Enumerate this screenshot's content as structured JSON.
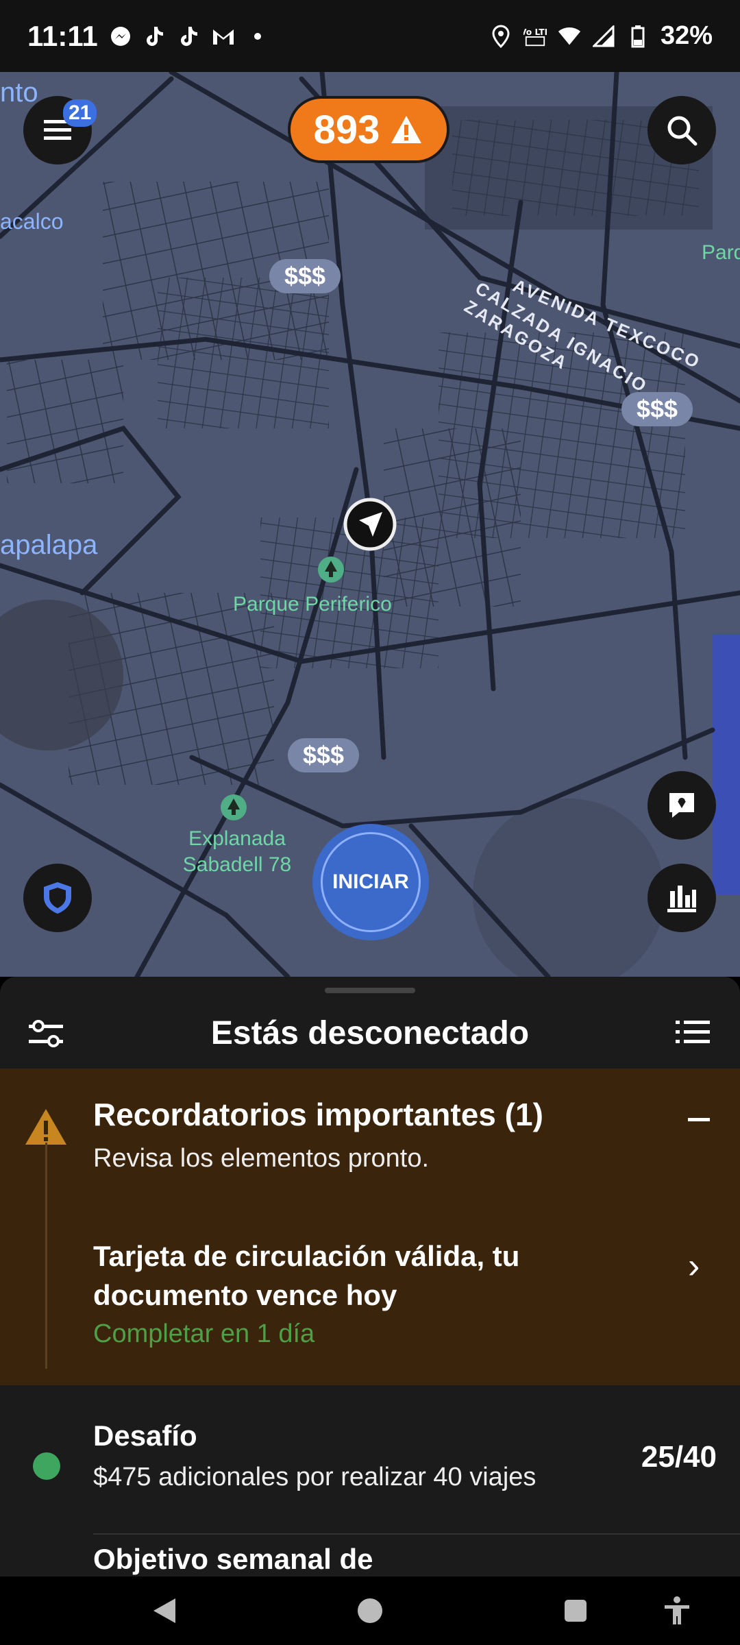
{
  "status_bar": {
    "time": "11:11",
    "left_icons": [
      "messenger-icon",
      "tiktok-icon",
      "tiktok-icon",
      "gmail-icon",
      "dot-icon"
    ],
    "right_icons": [
      "location-icon",
      "volte-icon",
      "wifi-icon",
      "signal-icon",
      "battery-icon"
    ],
    "volte_text": "Vo LTE",
    "battery": "32%"
  },
  "map": {
    "menu_badge": "21",
    "alert_count": "893",
    "partial_label_top": "nto",
    "labels": {
      "acalco": "acalco",
      "iztapalapa": "apalapa",
      "park_right": "Parq",
      "avenida": "AVENIDA TEXCOCO",
      "calzada": "CALZADA IGNACIO ZARAGOZA",
      "parque": "Parque Periferico",
      "explanada": "Explanada Sabadell 78"
    },
    "price_pills": [
      "$$$",
      "$$$",
      "$$$"
    ],
    "start_button": "INICIAR",
    "colors": {
      "map_bg": "#4d5772",
      "road": "#232a3a",
      "alert": "#f07a1a",
      "start": "#3b6acb"
    }
  },
  "sheet": {
    "title": "Estás desconectado",
    "reminder": {
      "title": "Recordatorios importantes (1)",
      "subtitle": "Revisa los elementos pronto.",
      "item": "Tarjeta de circulación válida, tu documento vence hoy",
      "due": "Completar en 1 día"
    },
    "challenge": {
      "title": "Desafío",
      "description": "$475 adicionales por realizar 40 viajes",
      "progress": "25/40"
    },
    "weekly_goal": "Objetivo semanal de"
  }
}
